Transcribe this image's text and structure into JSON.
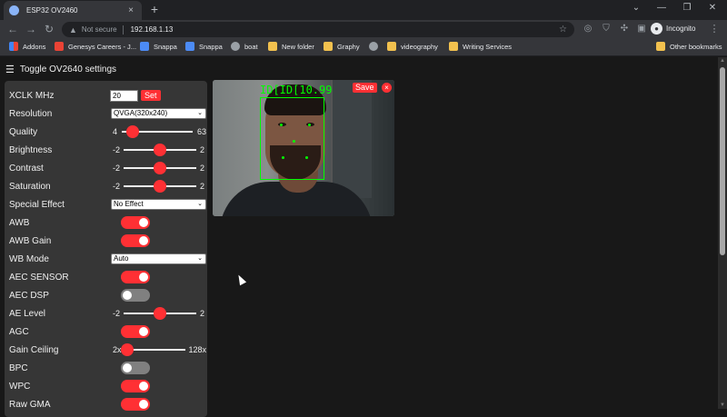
{
  "browser": {
    "tab_title": "ESP32 OV2460",
    "tab_close": "×",
    "new_tab": "+",
    "minimize": "⌄",
    "min2": "—",
    "restore": "❐",
    "close": "✕",
    "back": "←",
    "forward": "→",
    "reload": "↻",
    "not_secure": "Not secure",
    "url": "192.168.1.13",
    "incognito": "Incognito",
    "bookmarks": [
      {
        "label": "Addons",
        "icon": "grid"
      },
      {
        "label": "Genesys Careers - J...",
        "icon": "red"
      },
      {
        "label": "Snappa",
        "icon": "blue"
      },
      {
        "label": "Snappa",
        "icon": "blue"
      },
      {
        "label": "boat",
        "icon": "globe"
      },
      {
        "label": "New folder",
        "icon": "folder"
      },
      {
        "label": "Graphy",
        "icon": "folder"
      },
      {
        "label": "",
        "icon": "globe"
      },
      {
        "label": "videography",
        "icon": "folder"
      },
      {
        "label": "Writing Services",
        "icon": "folder"
      },
      {
        "label": "Other bookmarks",
        "icon": "folder"
      }
    ]
  },
  "page": {
    "toggle_label": "Toggle OV2640 settings",
    "xclk": {
      "label": "XCLK MHz",
      "value": "20",
      "button": "Set"
    },
    "resolution": {
      "label": "Resolution",
      "value": "QVGA(320x240)"
    },
    "quality": {
      "label": "Quality",
      "min": "4",
      "max": "63",
      "level": 0.15
    },
    "brightness": {
      "label": "Brightness",
      "min": "-2",
      "max": "2",
      "level": 0.5
    },
    "contrast": {
      "label": "Contrast",
      "min": "-2",
      "max": "2",
      "level": 0.5
    },
    "saturation": {
      "label": "Saturation",
      "min": "-2",
      "max": "2",
      "level": 0.5
    },
    "special_effect": {
      "label": "Special Effect",
      "value": "No Effect"
    },
    "awb": {
      "label": "AWB",
      "on": true
    },
    "awb_gain": {
      "label": "AWB Gain",
      "on": true
    },
    "wb_mode": {
      "label": "WB Mode",
      "value": "Auto"
    },
    "aec_sensor": {
      "label": "AEC SENSOR",
      "on": true
    },
    "aec_dsp": {
      "label": "AEC DSP",
      "on": false
    },
    "ae_level": {
      "label": "AE Level",
      "min": "-2",
      "max": "2",
      "level": 0.5
    },
    "agc": {
      "label": "AGC",
      "on": true
    },
    "gain_ceiling": {
      "label": "Gain Ceiling",
      "min": "2x",
      "max": "128x",
      "level": 0.0
    },
    "bpc": {
      "label": "BPC",
      "on": false
    },
    "wpc": {
      "label": "WPC",
      "on": true
    },
    "raw_gma": {
      "label": "Raw GMA",
      "on": true
    },
    "stream": {
      "overlay_text": "ID[ID[10.99",
      "save": "Save",
      "close": "×"
    }
  },
  "colors": {
    "accent": "#ff3034",
    "panel": "#363636",
    "background": "#181818"
  }
}
